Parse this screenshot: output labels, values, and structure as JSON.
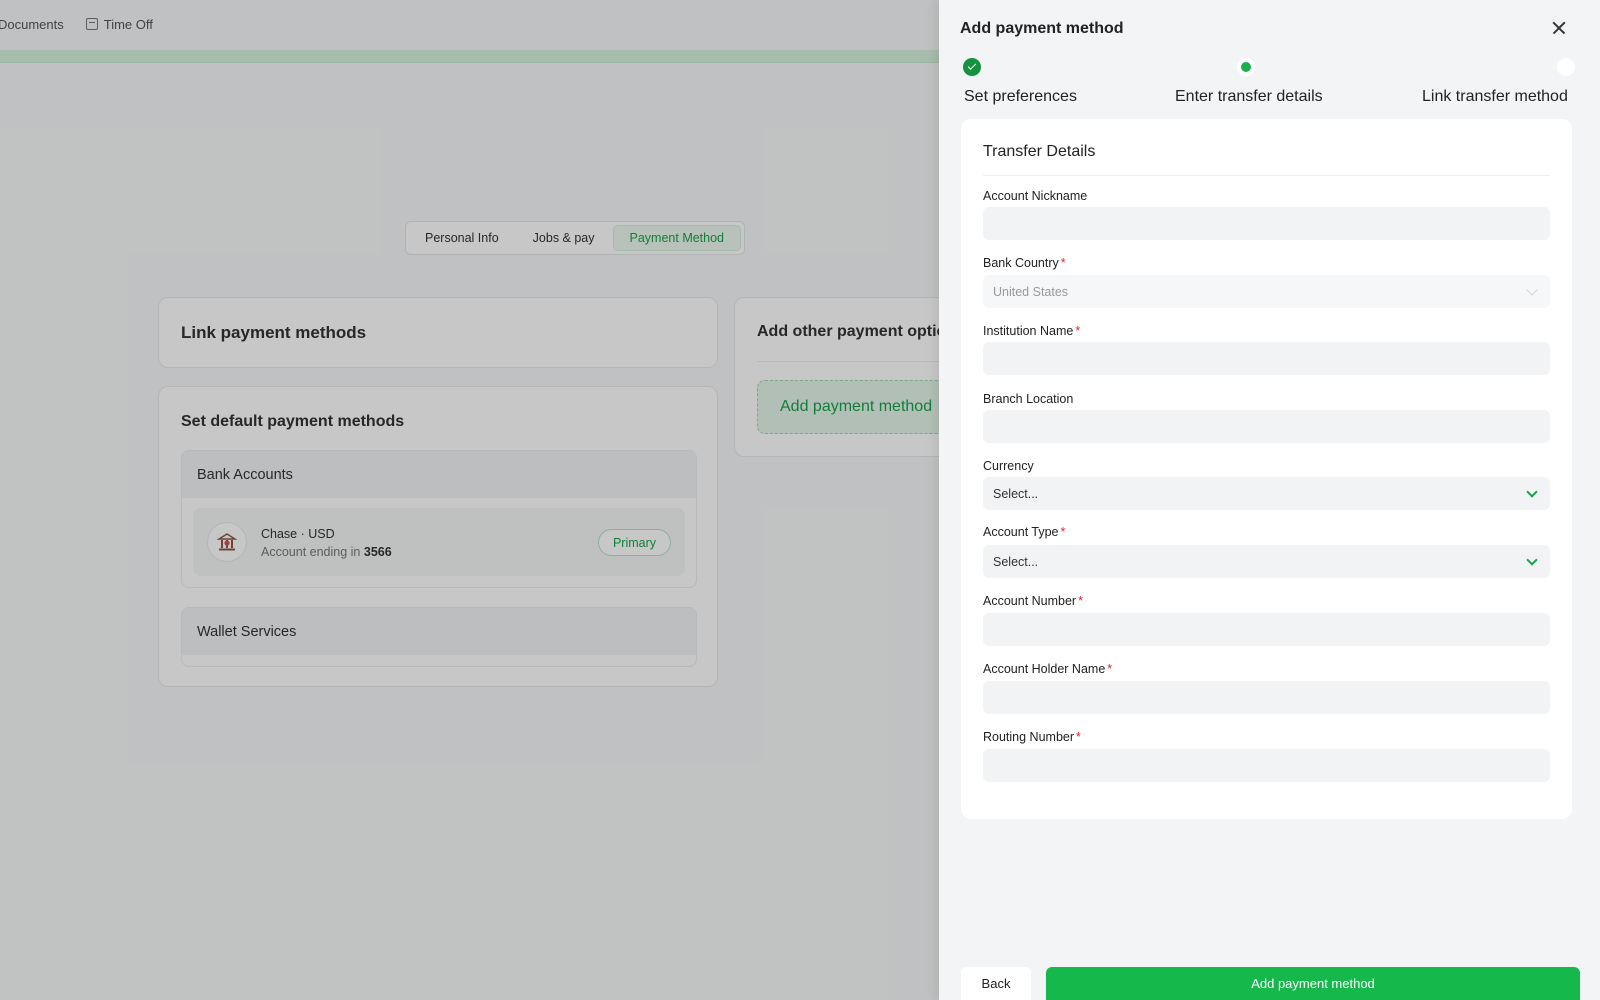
{
  "topnav": {
    "items": [
      {
        "label": "Documents"
      },
      {
        "label": "Time Off",
        "icon": "calendar-icon"
      }
    ]
  },
  "profile_tabs": [
    {
      "label": "Personal Info",
      "active": false
    },
    {
      "label": "Jobs & pay",
      "active": false
    },
    {
      "label": "Payment Method",
      "active": true
    }
  ],
  "link_card": {
    "title": "Link payment methods"
  },
  "default_card": {
    "title": "Set default payment methods",
    "bank_accounts": {
      "header": "Bank Accounts",
      "account": {
        "name": "Chase · USD",
        "ending_prefix": "Account ending in",
        "ending_digits": "3566",
        "badge": "Primary",
        "icon": "bank-icon"
      }
    },
    "wallet_services": {
      "header": "Wallet Services"
    }
  },
  "other_card": {
    "title": "Add other payment options",
    "add_button": "Add payment method"
  },
  "drawer": {
    "title": "Add payment method",
    "close_icon": "close-icon",
    "steps": [
      {
        "label": "Set preferences",
        "status": "complete"
      },
      {
        "label": "Enter transfer details",
        "status": "current"
      },
      {
        "label": "Link transfer method",
        "status": "upcoming"
      }
    ],
    "form": {
      "title": "Transfer Details",
      "account_nickname": {
        "label": "Account Nickname",
        "required": false,
        "value": ""
      },
      "bank_country": {
        "label": "Bank Country",
        "required": true,
        "value": "United States",
        "disabled": true
      },
      "institution_name": {
        "label": "Institution Name",
        "required": true,
        "value": ""
      },
      "branch_location": {
        "label": "Branch Location",
        "required": false,
        "value": ""
      },
      "currency": {
        "label": "Currency",
        "required": false,
        "value": "Select..."
      },
      "account_type": {
        "label": "Account Type",
        "required": true,
        "value": "Select..."
      },
      "account_number": {
        "label": "Account Number",
        "required": true,
        "value": ""
      },
      "account_holder_name": {
        "label": "Account Holder Name",
        "required": true,
        "value": ""
      },
      "routing_number": {
        "label": "Routing Number",
        "required": true,
        "value": ""
      },
      "required_marker": "*"
    },
    "footer": {
      "back": "Back",
      "submit": "Add payment method"
    }
  },
  "colors": {
    "accent": "#15b84b",
    "accent_text": "#17a34a",
    "required": "#e02424"
  }
}
